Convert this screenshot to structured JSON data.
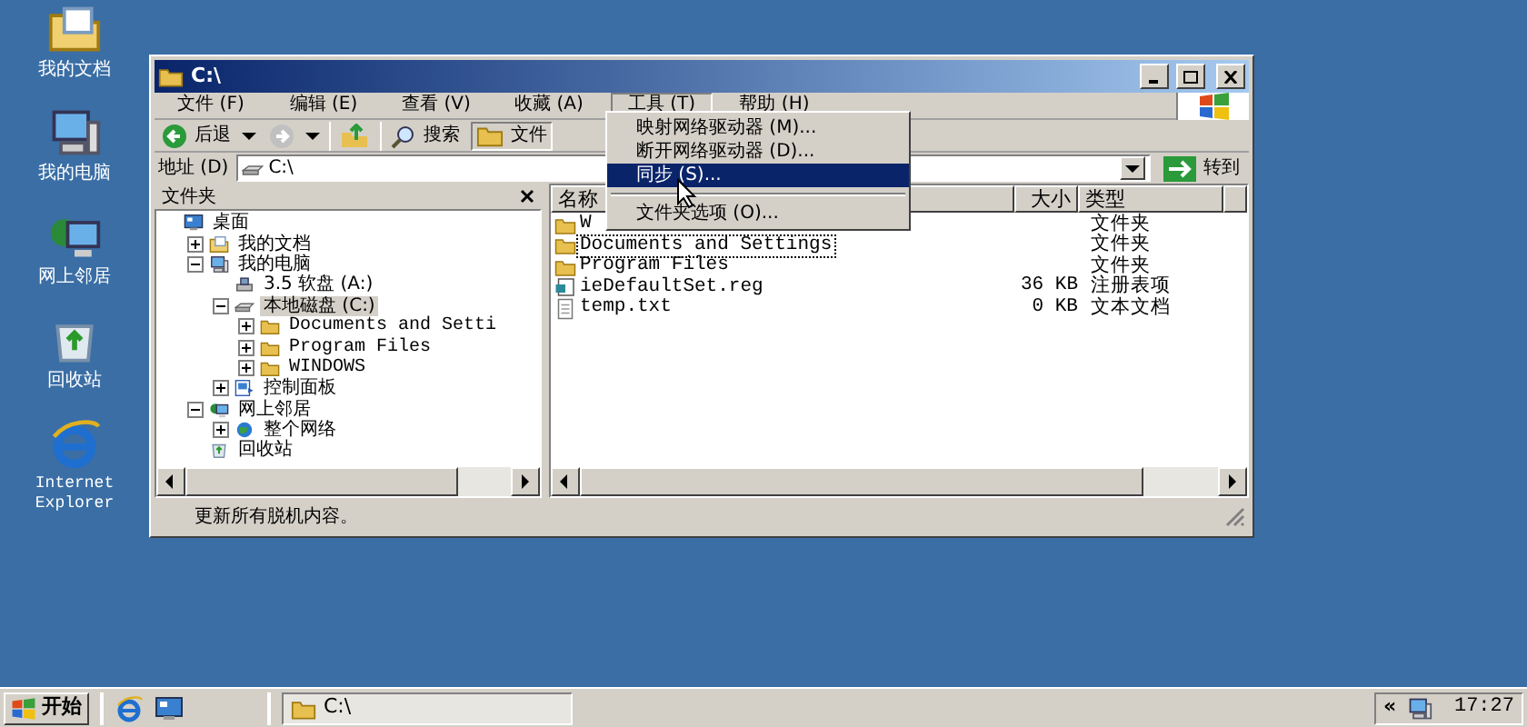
{
  "desktop_icons": [
    {
      "label": "我的文档",
      "kind": "documents"
    },
    {
      "label": "我的电脑",
      "kind": "computer"
    },
    {
      "label": "网上邻居",
      "kind": "network"
    },
    {
      "label": "回收站",
      "kind": "recycle"
    },
    {
      "label": "Internet Explorer",
      "kind": "ie"
    }
  ],
  "window": {
    "title": "C:\\",
    "menu": [
      {
        "label": "文件 (F)",
        "open": false
      },
      {
        "label": "编辑 (E)",
        "open": false
      },
      {
        "label": "查看 (V)",
        "open": false
      },
      {
        "label": "收藏 (A)",
        "open": false
      },
      {
        "label": "工具 (T)",
        "open": true
      },
      {
        "label": "帮助 (H)",
        "open": false
      }
    ],
    "dropdown": [
      {
        "kind": "item",
        "label": "映射网络驱动器 (M)...",
        "selected": false
      },
      {
        "kind": "item",
        "label": "断开网络驱动器 (D)...",
        "selected": false
      },
      {
        "kind": "item",
        "label": "同步 (S)...",
        "selected": true
      },
      {
        "kind": "separator"
      },
      {
        "kind": "item",
        "label": "文件夹选项 (O)...",
        "selected": false
      }
    ],
    "toolbar": [
      {
        "kind": "back",
        "label": "后退"
      },
      {
        "kind": "forward"
      },
      {
        "kind": "up"
      },
      {
        "kind": "search",
        "label": "搜索"
      },
      {
        "kind": "folders",
        "label": "文件"
      }
    ],
    "address": {
      "label": "地址 (D)",
      "value": "C:\\",
      "go": "转到"
    },
    "folders_pane": {
      "title": "文件夹",
      "tree": [
        {
          "label": "桌面",
          "kind": "desktop",
          "expandable": false,
          "selected": false,
          "children": [
            {
              "label": "我的文档",
              "kind": "documents",
              "expandable": true,
              "expanded": false,
              "selected": false
            },
            {
              "label": "我的电脑",
              "kind": "computer",
              "expandable": true,
              "expanded": true,
              "selected": false,
              "children": [
                {
                  "label": "3.5 软盘 (A:)",
                  "kind": "floppy",
                  "expandable": false,
                  "selected": false
                },
                {
                  "label": "本地磁盘 (C:)",
                  "kind": "drive",
                  "expandable": true,
                  "expanded": true,
                  "selected": true,
                  "children": [
                    {
                      "label": "Documents and Setti",
                      "kind": "folder",
                      "expandable": true,
                      "expanded": false,
                      "selected": false
                    },
                    {
                      "label": "Program Files",
                      "kind": "folder",
                      "expandable": true,
                      "expanded": false,
                      "selected": false
                    },
                    {
                      "label": "WINDOWS",
                      "kind": "folder",
                      "expandable": true,
                      "expanded": false,
                      "selected": false
                    }
                  ]
                },
                {
                  "label": "控制面板",
                  "kind": "control",
                  "expandable": true,
                  "expanded": false,
                  "selected": false
                }
              ]
            },
            {
              "label": "网上邻居",
              "kind": "network",
              "expandable": true,
              "expanded": true,
              "selected": false,
              "children": [
                {
                  "label": "整个网络",
                  "kind": "globe",
                  "expandable": true,
                  "expanded": false,
                  "selected": false
                }
              ]
            },
            {
              "label": "回收站",
              "kind": "recycle",
              "expandable": false,
              "selected": false
            }
          ]
        }
      ]
    },
    "file_list": {
      "columns": [
        "名称",
        "大小",
        "类型"
      ],
      "rows": [
        {
          "name": "W",
          "kind": "folder",
          "type": "文件夹",
          "selected": false
        },
        {
          "name": "Documents and Settings",
          "kind": "folder",
          "type": "文件夹",
          "selected": true
        },
        {
          "name": "Program Files",
          "kind": "folder",
          "type": "文件夹",
          "selected": false
        },
        {
          "name": "ieDefaultSet.reg",
          "kind": "reg",
          "size": "36 KB",
          "type": "注册表项",
          "selected": false
        },
        {
          "name": "temp.txt",
          "kind": "txt",
          "size": "0 KB",
          "type": "文本文档",
          "selected": false
        }
      ]
    },
    "status_bar": "更新所有脱机内容。"
  },
  "taskbar": {
    "start": "开始",
    "tasks": [
      {
        "label": "C:\\",
        "kind": "folder"
      }
    ],
    "tray_arrow": "«",
    "clock": "17:27"
  }
}
